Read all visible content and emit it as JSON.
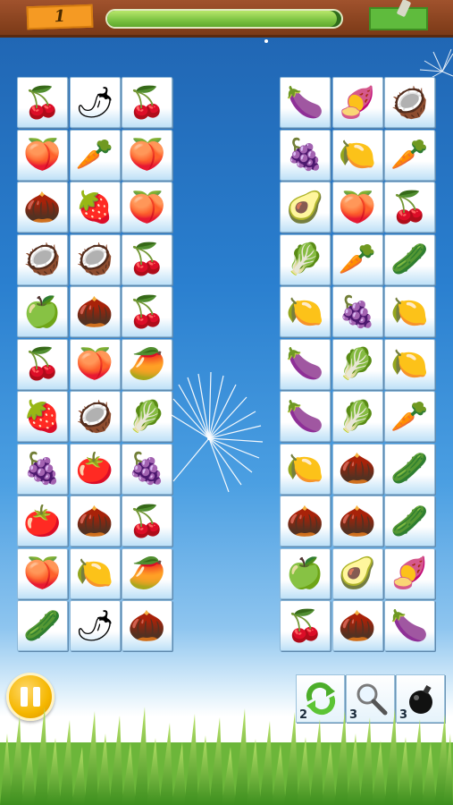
{
  "header": {
    "level": "1",
    "timer_progress": 0.98
  },
  "left_board": {
    "columns": 3,
    "tiles": [
      [
        "cherry",
        "pepper",
        "cherry"
      ],
      [
        "peach",
        "radish",
        "peach"
      ],
      [
        "durian",
        "strawberry",
        "peach-pink"
      ],
      [
        "mangosteen",
        "mangosteen",
        "cherry"
      ],
      [
        "apple",
        "durian",
        "cherry"
      ],
      [
        "cherry",
        "peach",
        "mango"
      ],
      [
        "strawberry",
        "mangosteen",
        "cabbage"
      ],
      [
        "currant",
        "tomato-vine",
        "grape"
      ],
      [
        "tomato-vine",
        "durian",
        "cherry"
      ],
      [
        "peach-pink",
        "lemon",
        "mango"
      ],
      [
        "leek",
        "pepper",
        "chestnut"
      ]
    ]
  },
  "right_board": {
    "columns": 3,
    "tiles": [
      [
        "eggplant",
        "sweet-potato",
        "mangosteen"
      ],
      [
        "currant",
        "lemon",
        "radish"
      ],
      [
        "avocado",
        "peach",
        "cherry"
      ],
      [
        "cabbage",
        "radish-pink",
        "leek"
      ],
      [
        "lemon",
        "grape",
        "lemon"
      ],
      [
        "eggplant",
        "cabbage",
        "lemon"
      ],
      [
        "eggplant",
        "cabbage",
        "radish-pink"
      ],
      [
        "lemon",
        "durian",
        "leek"
      ],
      [
        "durian",
        "chestnut",
        "leek"
      ],
      [
        "apple",
        "avocado",
        "sweet-potato"
      ],
      [
        "cherry",
        "durian",
        "eggplant"
      ]
    ]
  },
  "icons": {
    "cherry": "🍒",
    "pepper": "🌶",
    "peach": "🍑",
    "peach-pink": "🍑",
    "radish": "🥕",
    "radish-pink": "🥕",
    "durian": "🌰",
    "strawberry": "🍓",
    "mangosteen": "🥥",
    "apple": "🍏",
    "mango": "🥭",
    "cabbage": "🥬",
    "currant": "🍇",
    "tomato-vine": "🍅",
    "grape": "🍇",
    "lemon": "🍋",
    "leek": "🥒",
    "chestnut": "🌰",
    "eggplant": "🍆",
    "sweet-potato": "🍠",
    "avocado": "🥑"
  },
  "powerups": {
    "shuffle": {
      "count": "2",
      "icon": "shuffle-icon"
    },
    "hint": {
      "count": "3",
      "icon": "magnifier-icon"
    },
    "bomb": {
      "count": "3",
      "icon": "bomb-icon"
    }
  },
  "colors": {
    "timer_fill": "#7bc241",
    "level_badge": "#f59a23",
    "score_badge": "#5fbb3d"
  }
}
